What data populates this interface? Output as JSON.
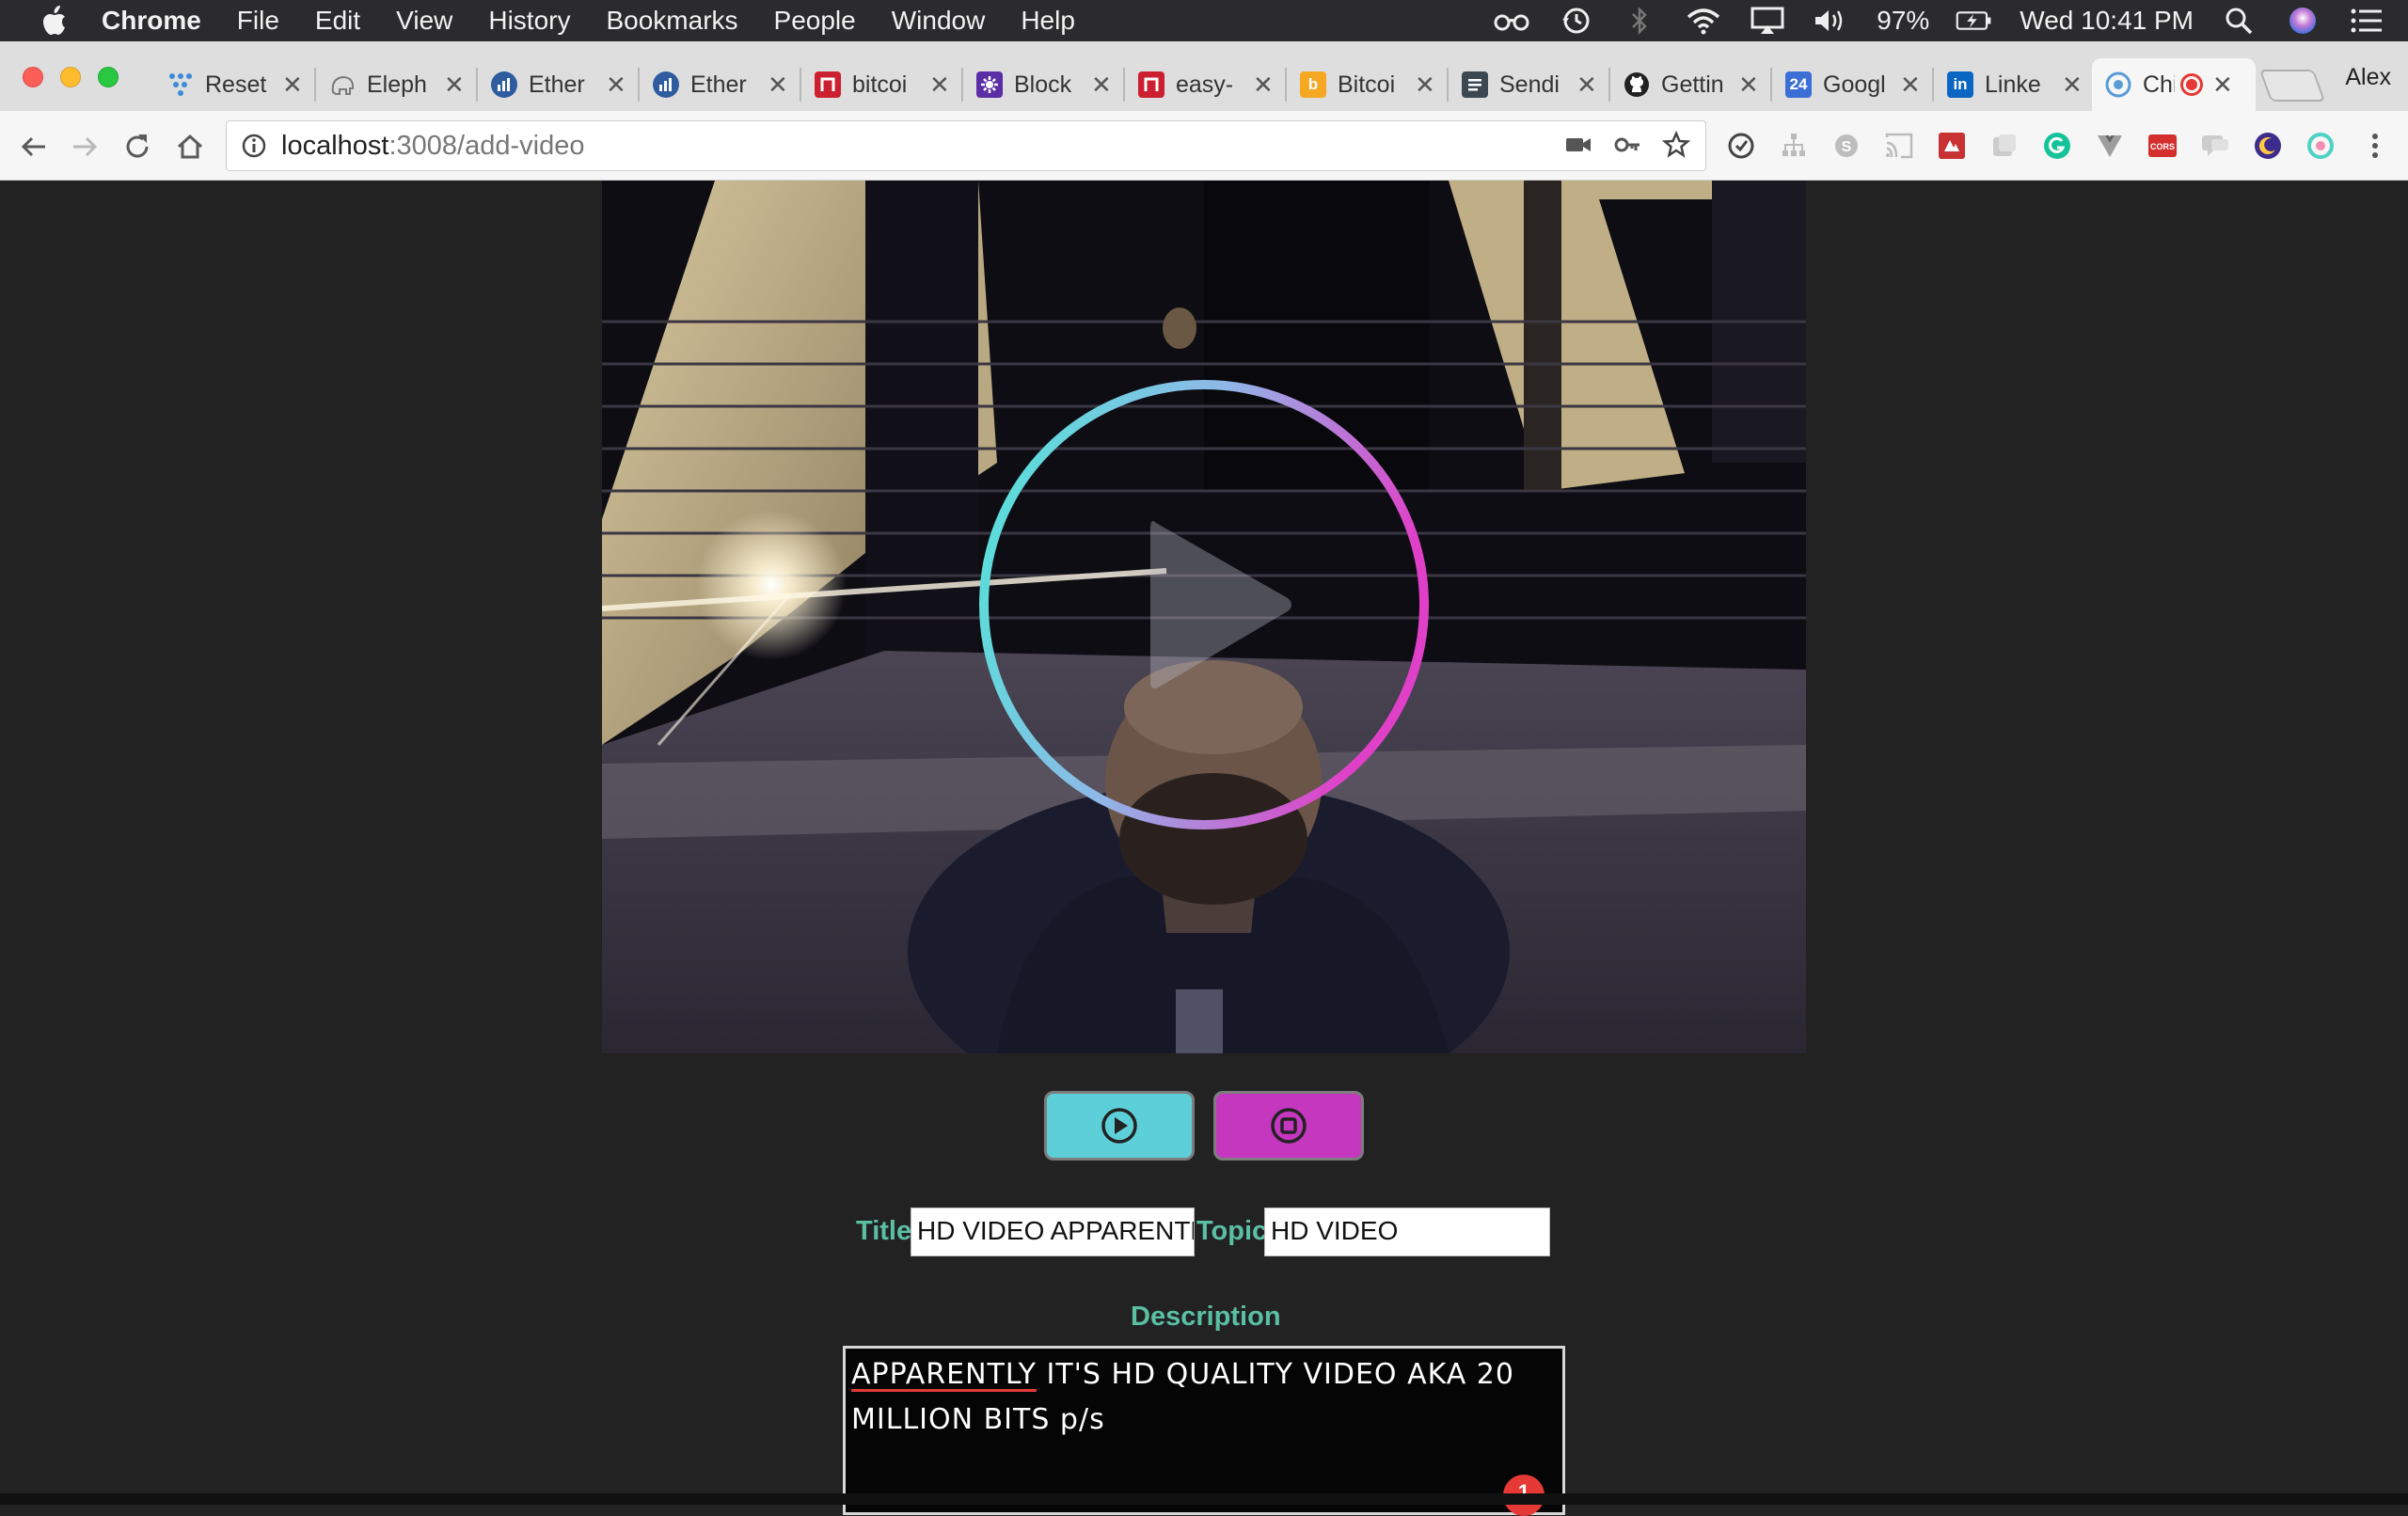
{
  "menubar": {
    "app_name": "Chrome",
    "items": [
      "File",
      "Edit",
      "View",
      "History",
      "Bookmarks",
      "People",
      "Window",
      "Help"
    ],
    "battery": "97%",
    "clock": "Wed 10:41 PM",
    "icons": [
      "glasses-icon",
      "time-machine-icon",
      "bluetooth-icon",
      "wifi-icon",
      "airplay-icon",
      "volume-icon",
      "battery-icon",
      "spotlight-icon",
      "siri-icon",
      "notification-center-icon"
    ]
  },
  "tabs": [
    {
      "title": "Reset",
      "favicon": "dots",
      "color": "#3d8bd9"
    },
    {
      "title": "Eleph",
      "favicon": "elephant",
      "color": "#8a8a8a"
    },
    {
      "title": "Ether",
      "favicon": "chart",
      "color": "#2e5c9e"
    },
    {
      "title": "Ether",
      "favicon": "chart",
      "color": "#2e5c9e"
    },
    {
      "title": "bitcoi",
      "favicon": "n",
      "color": "#cc2030"
    },
    {
      "title": "Block",
      "favicon": "gear",
      "color": "#5b2ea6"
    },
    {
      "title": "easy-",
      "favicon": "n",
      "color": "#cc2030"
    },
    {
      "title": "Bitcoi",
      "favicon": "b",
      "color": "#f7a823"
    },
    {
      "title": "Sendi",
      "favicon": "list",
      "color": "#3b4852"
    },
    {
      "title": "Gettin",
      "favicon": "github",
      "color": "#222222"
    },
    {
      "title": "Googl",
      "favicon": "24",
      "color": "#3b6fd6"
    },
    {
      "title": "Linke",
      "favicon": "in",
      "color": "#0a66c2"
    },
    {
      "title": "Chi",
      "favicon": "chrome",
      "color": "#5a9bd5",
      "active": true,
      "recording": true
    }
  ],
  "profile_name": "Alex",
  "address_bar": {
    "host": "localhost",
    "path": ":3008/add-video"
  },
  "form": {
    "title_label": "Title",
    "title_value": "HD VIDEO APPARENTLY",
    "topic_label": "Topic",
    "topic_value": "HD VIDEO",
    "description_label": "Description",
    "description_misspelled": "APPARENTLY",
    "description_rest": " IT'S HD QUALITY VIDEO AKA 20 MILLION BITS p/s",
    "notification_count": "1"
  },
  "colors": {
    "record_button": "#5dcfd9",
    "stop_button": "#c437be",
    "label_green": "#5ac0a1",
    "ring_start": "#4ee6d6",
    "ring_end": "#e040c8"
  }
}
